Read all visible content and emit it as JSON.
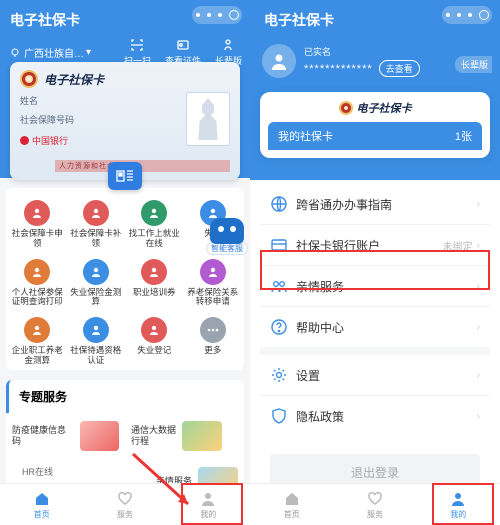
{
  "left": {
    "header": {
      "title": "电子社保卡",
      "location": "广西壮族自…"
    },
    "header_actions": [
      {
        "icon": "scan-icon",
        "label": "扫一扫"
      },
      {
        "icon": "badge-icon",
        "label": "查看证件"
      },
      {
        "icon": "elder-icon",
        "label": "长辈版"
      }
    ],
    "card": {
      "title": "电子社保卡",
      "rows": {
        "name_label": "姓名",
        "ssn_label": "社会保障号码"
      },
      "bank": "中国银行",
      "strip": "人力资源和社会保障部"
    },
    "robot_label": "智能客服",
    "grid": [
      {
        "label": "社会保障卡申\n领",
        "color": "#e05a5a"
      },
      {
        "label": "社会保障卡补\n领",
        "color": "#e05a5a"
      },
      {
        "label": "找工作上就业\n在线",
        "color": "#2f9a6a"
      },
      {
        "label": "失业",
        "color": "#3b8ee3"
      },
      {
        "label": "个人社保参保\n证明查询打印",
        "color": "#e07b3a"
      },
      {
        "label": "失业保险金测\n算",
        "color": "#3b8ee3"
      },
      {
        "label": "职业培训券",
        "color": "#e05a5a"
      },
      {
        "label": "养老保险关系\n转移申请",
        "color": "#b25ad0"
      },
      {
        "label": "企业职工养老\n金测算",
        "color": "#e07b3a"
      },
      {
        "label": "社保待遇资格\n认证",
        "color": "#3b8ee3"
      },
      {
        "label": "失业登记",
        "color": "#e05a5a"
      },
      {
        "label": "更多",
        "color": "#9aa3b0"
      }
    ],
    "section": "专题服务",
    "services": [
      {
        "label": "防疫健康信息码"
      },
      {
        "label": "通信大数据\n行程"
      },
      {
        "label": "亲情服务"
      }
    ],
    "hr_item": "HR在线",
    "tabs": [
      {
        "label": "首页",
        "icon": "home-icon",
        "active": true
      },
      {
        "label": "服务",
        "icon": "heart-icon",
        "active": false
      },
      {
        "label": "我的",
        "icon": "person-icon",
        "active": false
      }
    ]
  },
  "right": {
    "header": {
      "title": "电子社保卡",
      "verified": "已实名",
      "masked": "*************",
      "view_btn": "去查看",
      "elder": "长辈版"
    },
    "panel": {
      "brand": "电子社保卡",
      "mycard": "我的社保卡",
      "count": "1张"
    },
    "list1": [
      {
        "icon": "globe-icon",
        "label": "跨省通办办事指南",
        "right": ""
      },
      {
        "icon": "card-icon",
        "label": "社保卡银行账户",
        "right": "未绑定"
      },
      {
        "icon": "people-icon",
        "label": "亲情服务",
        "right": ""
      },
      {
        "icon": "help-icon",
        "label": "帮助中心",
        "right": ""
      }
    ],
    "list2": [
      {
        "icon": "gear-icon",
        "label": "设置",
        "right": ""
      },
      {
        "icon": "shield-icon",
        "label": "隐私政策",
        "right": ""
      }
    ],
    "logout": "退出登录",
    "tabs": [
      {
        "label": "首页",
        "icon": "home-icon",
        "active": false
      },
      {
        "label": "服务",
        "icon": "heart-icon",
        "active": false
      },
      {
        "label": "我的",
        "icon": "person-icon",
        "active": true
      }
    ]
  }
}
